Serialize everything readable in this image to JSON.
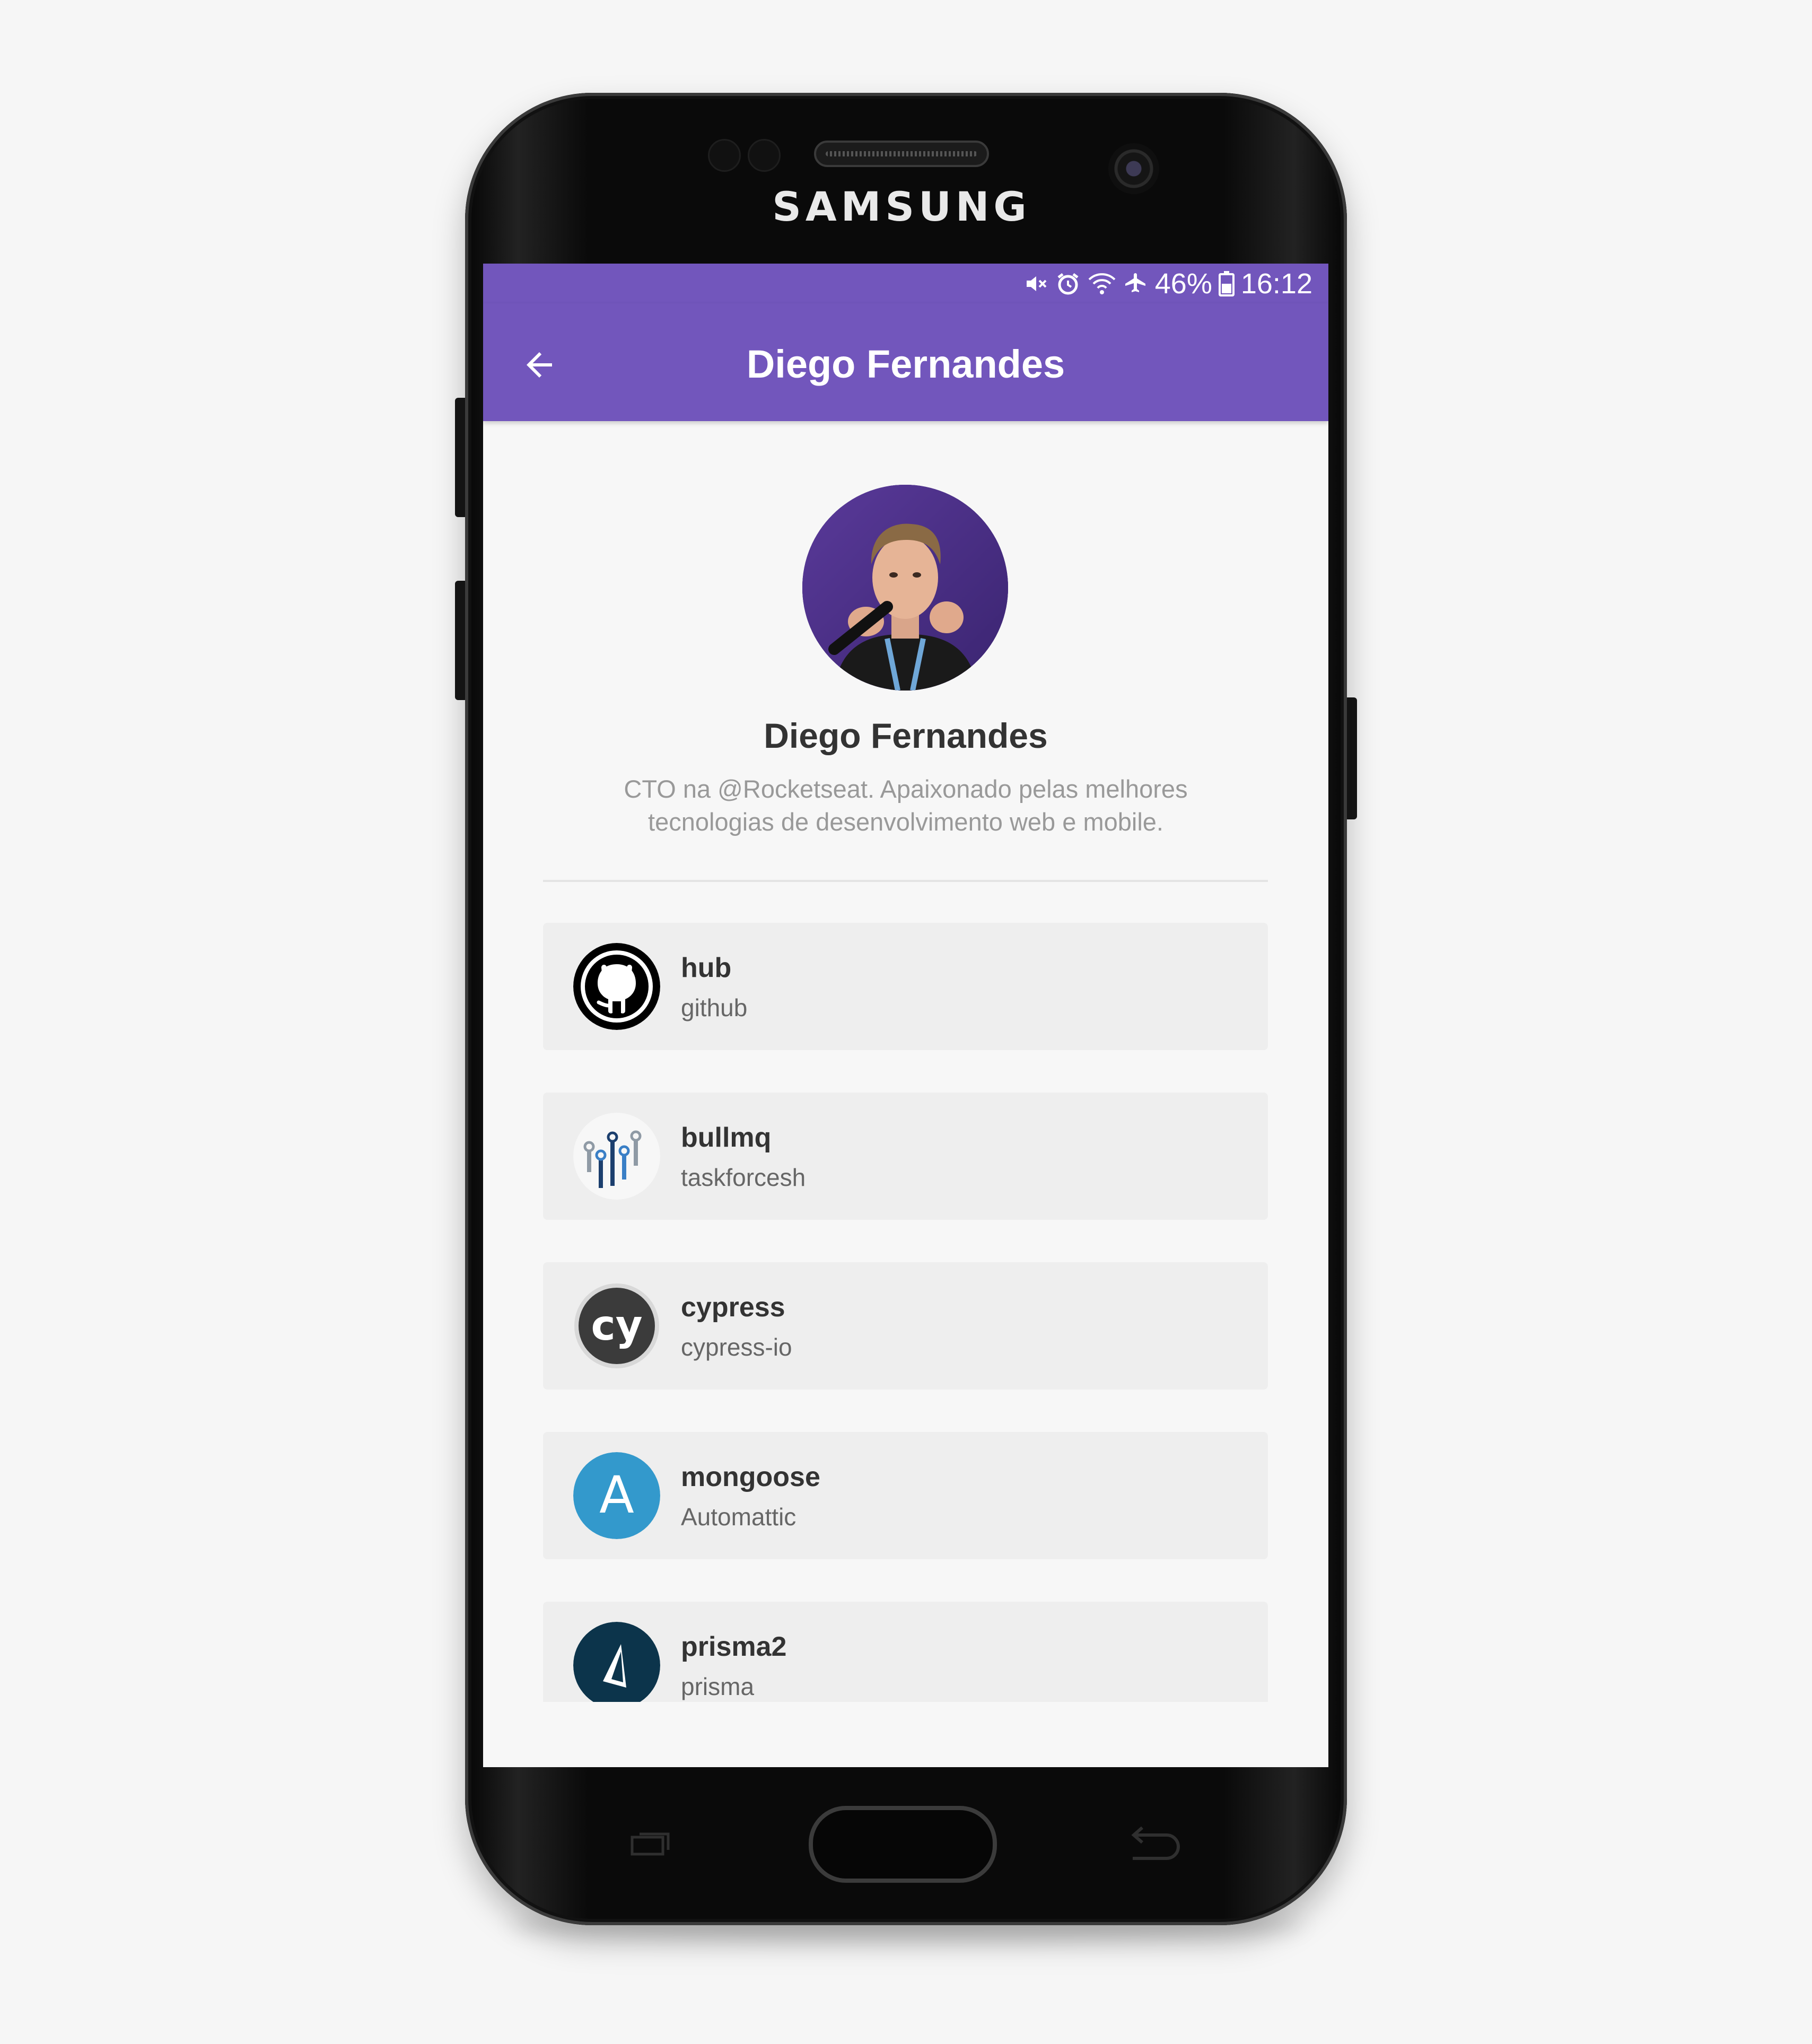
{
  "device": {
    "brand": "SAMSUNG"
  },
  "status_bar": {
    "battery": "46%",
    "time": "16:12",
    "icons": [
      "mute-icon",
      "alarm-icon",
      "wifi-icon",
      "airplane-icon",
      "battery-icon"
    ]
  },
  "header": {
    "title": "Diego Fernandes",
    "back_icon": "arrow-left-icon"
  },
  "profile": {
    "name": "Diego Fernandes",
    "bio_line1": "CTO na @Rocketseat. Apaixonado pelas melhores",
    "bio_line2": "tecnologias de desenvolvimento web e mobile."
  },
  "repositories": [
    {
      "name": "hub",
      "owner": "github",
      "icon": "github-icon"
    },
    {
      "name": "bullmq",
      "owner": "taskforcesh",
      "icon": "bullmq-icon"
    },
    {
      "name": "cypress",
      "owner": "cypress-io",
      "icon": "cypress-icon",
      "icon_text": "cy"
    },
    {
      "name": "mongoose",
      "owner": "Automattic",
      "icon": "automattic-icon",
      "icon_text": "A"
    },
    {
      "name": "prisma2",
      "owner": "prisma",
      "icon": "prisma-icon"
    }
  ],
  "colors": {
    "primary": "#7256bc",
    "background": "#f7f7f7",
    "card": "#eeeeee",
    "title_text": "#333333",
    "bio_text": "#999999"
  }
}
